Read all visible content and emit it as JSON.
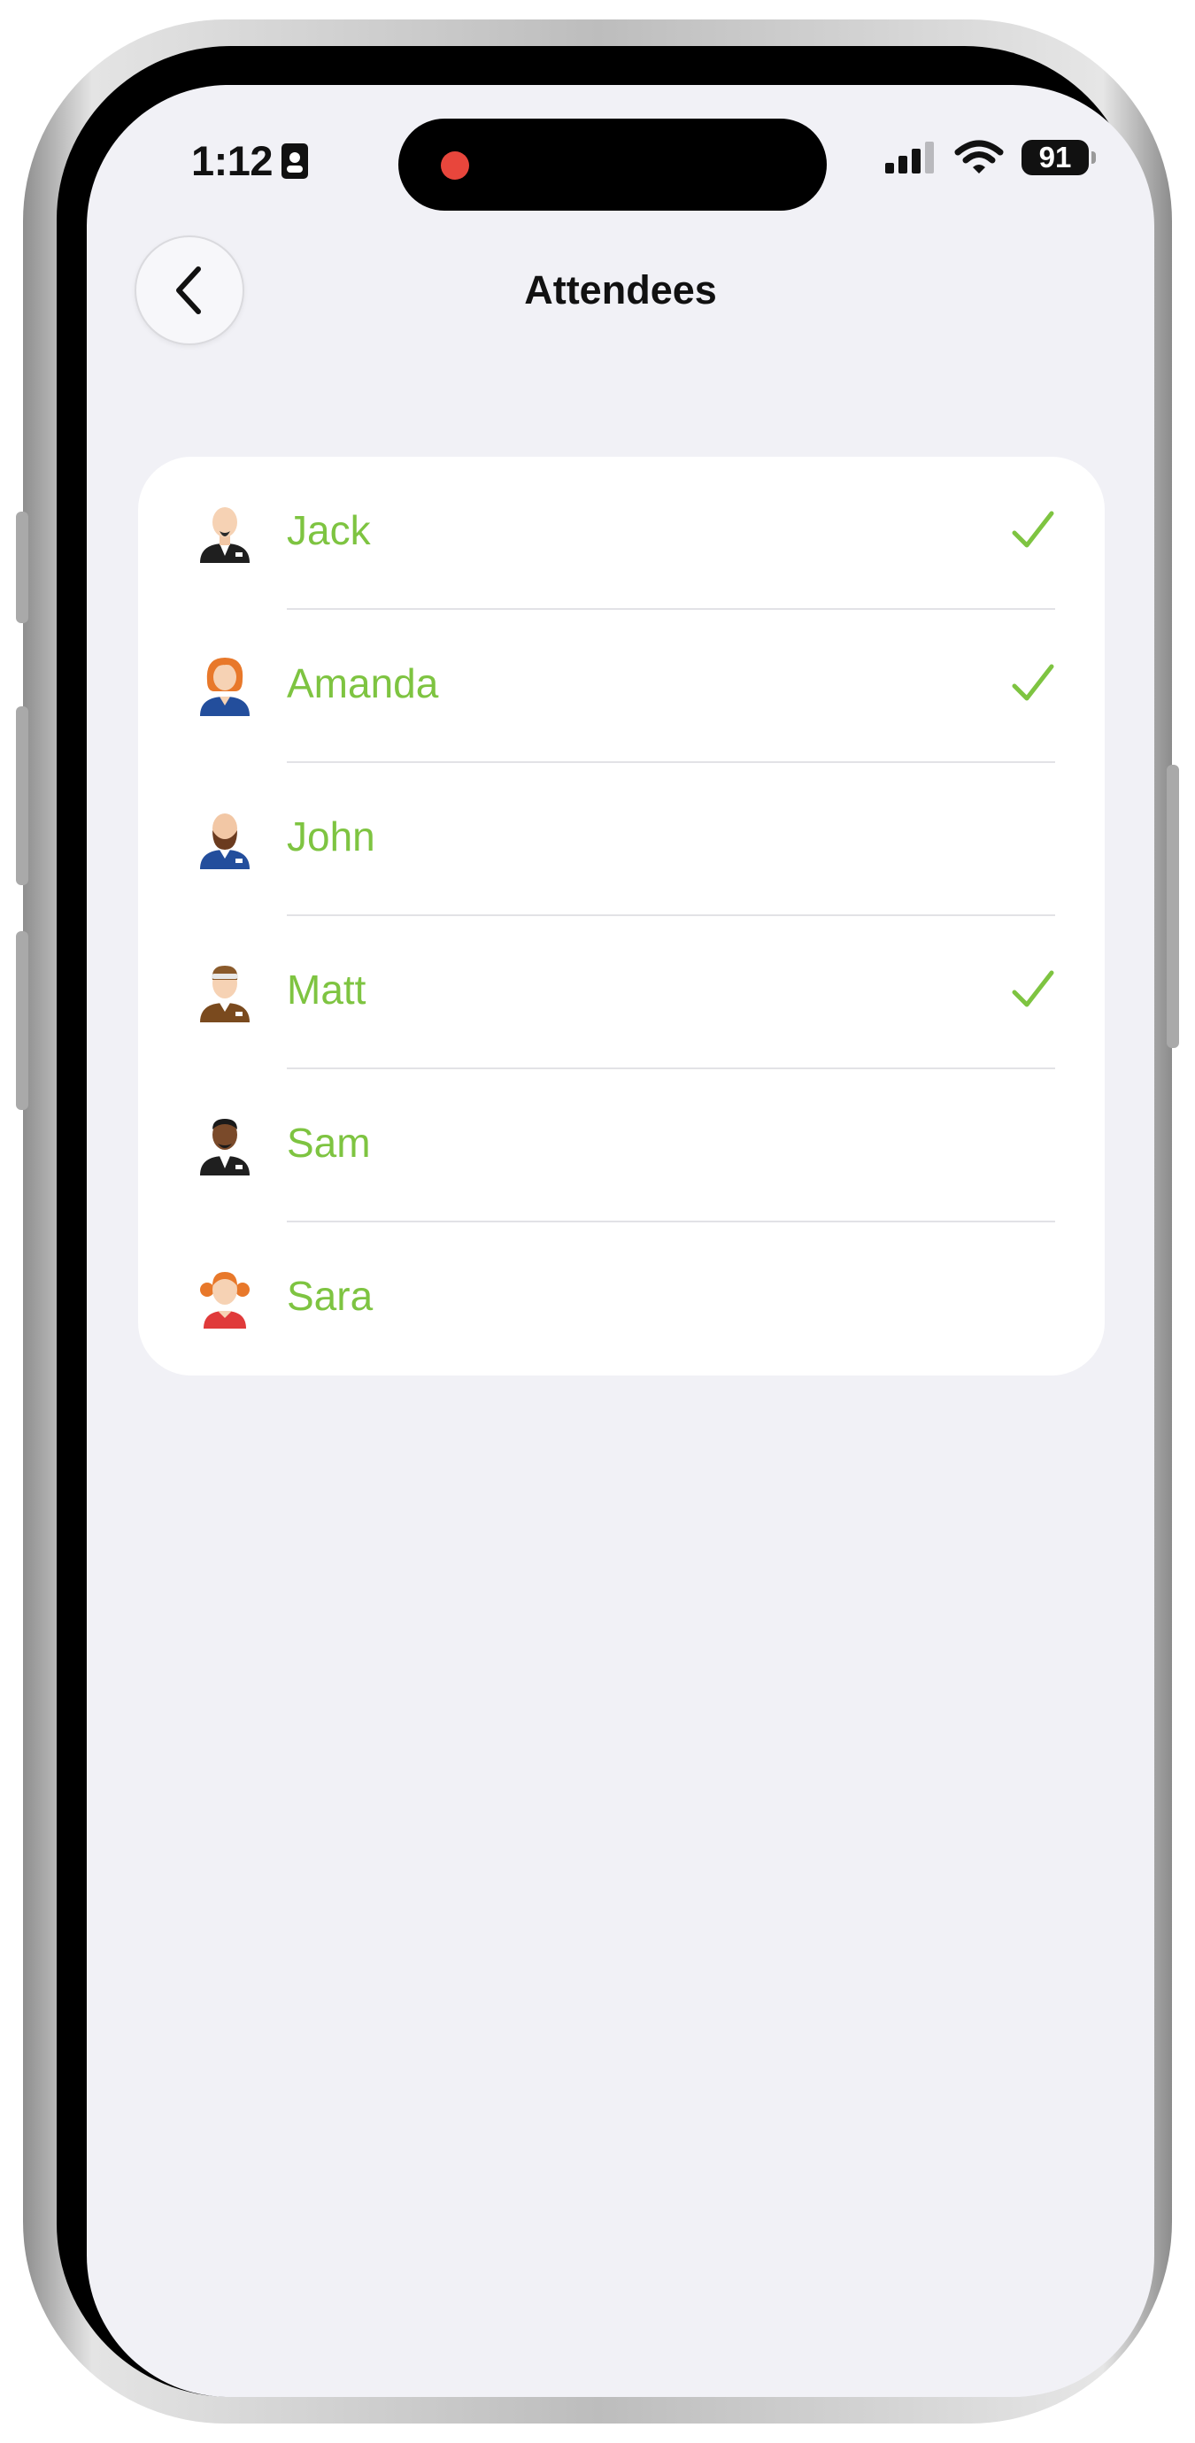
{
  "status_bar": {
    "time": "1:12",
    "battery": "91"
  },
  "nav": {
    "title": "Attendees"
  },
  "attendees": [
    {
      "name": "Jack",
      "checked": true
    },
    {
      "name": "Amanda",
      "checked": true
    },
    {
      "name": "John",
      "checked": false
    },
    {
      "name": "Matt",
      "checked": true
    },
    {
      "name": "Sam",
      "checked": false
    },
    {
      "name": "Sara",
      "checked": false
    }
  ],
  "colors": {
    "accent": "#7ec441",
    "background": "#f1f1f6",
    "card": "#ffffff"
  }
}
